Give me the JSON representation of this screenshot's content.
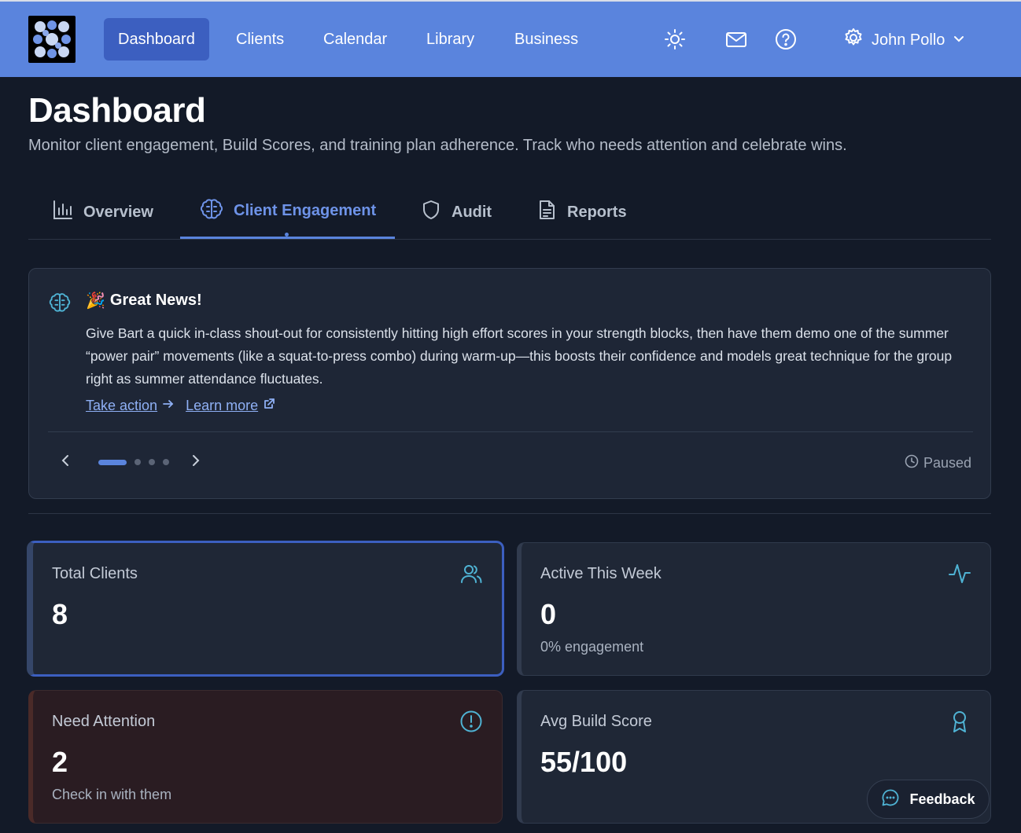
{
  "nav": {
    "items": [
      {
        "label": "Dashboard",
        "active": true
      },
      {
        "label": "Clients"
      },
      {
        "label": "Calendar"
      },
      {
        "label": "Library"
      },
      {
        "label": "Business"
      }
    ],
    "icons": [
      "sun-icon",
      "mail-icon",
      "help-icon",
      "gear-icon"
    ],
    "user_name": "John Pollo"
  },
  "page": {
    "title": "Dashboard",
    "subtitle": "Monitor client engagement, Build Scores, and training plan adherence. Track who needs attention and celebrate wins."
  },
  "tabs": [
    {
      "label": "Overview",
      "icon": "bar-chart-icon"
    },
    {
      "label": "Client Engagement",
      "icon": "brain-icon",
      "active": true
    },
    {
      "label": "Audit",
      "icon": "shield-icon"
    },
    {
      "label": "Reports",
      "icon": "document-icon"
    }
  ],
  "news": {
    "emoji": "🎉",
    "title": "Great News!",
    "body": "Give Bart a quick in-class shout-out for consistently hitting high effort scores in your strength blocks, then have them demo one of the summer “power pair” movements (like a squat-to-press combo) during warm-up—this boosts their confidence and models great technique for the group right as summer attendance fluctuates.",
    "take_action": "Take action",
    "learn_more": "Learn more",
    "status": "Paused",
    "slide_count": 4,
    "current_slide": 1
  },
  "stats": {
    "total_clients": {
      "label": "Total Clients",
      "value": "8"
    },
    "active_week": {
      "label": "Active This Week",
      "value": "0",
      "note": "0% engagement"
    },
    "need_attention": {
      "label": "Need Attention",
      "value": "2",
      "note": "Check in with them"
    },
    "avg_build": {
      "label": "Avg Build Score",
      "value": "55/100"
    }
  },
  "feedback_label": "Feedback",
  "colors": {
    "accent": "#5a84dd",
    "teal": "#4fb3d4"
  }
}
